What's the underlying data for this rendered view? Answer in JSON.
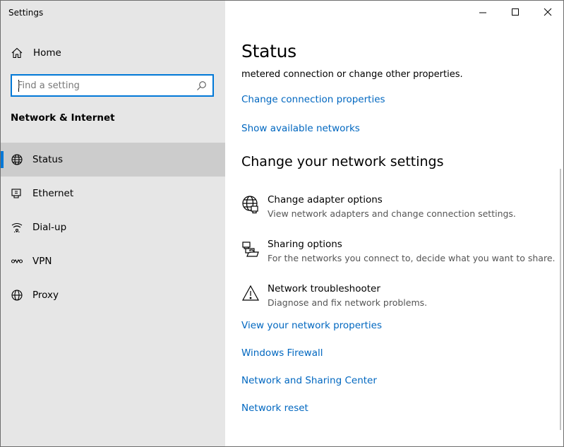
{
  "window": {
    "title": "Settings"
  },
  "sidebar": {
    "home_label": "Home",
    "search_placeholder": "Find a setting",
    "section_title": "Network & Internet",
    "items": [
      {
        "label": "Status",
        "icon": "globe-icon",
        "active": true
      },
      {
        "label": "Ethernet",
        "icon": "ethernet-icon",
        "active": false
      },
      {
        "label": "Dial-up",
        "icon": "dialup-icon",
        "active": false
      },
      {
        "label": "VPN",
        "icon": "vpn-icon",
        "active": false
      },
      {
        "label": "Proxy",
        "icon": "globe-icon",
        "active": false
      }
    ]
  },
  "main": {
    "title": "Status",
    "partial_text": "metered connection or change other properties.",
    "links_top": [
      "Change connection properties",
      "Show available networks"
    ],
    "section_title": "Change your network settings",
    "options": [
      {
        "title": "Change adapter options",
        "description": "View network adapters and change connection settings.",
        "icon": "adapter-icon"
      },
      {
        "title": "Sharing options",
        "description": "For the networks you connect to, decide what you want to share.",
        "icon": "sharing-icon"
      },
      {
        "title": "Network troubleshooter",
        "description": "Diagnose and fix network problems.",
        "icon": "warning-icon"
      }
    ],
    "links_bottom": [
      "View your network properties",
      "Windows Firewall",
      "Network and Sharing Center",
      "Network reset"
    ]
  },
  "colors": {
    "accent": "#0078d7",
    "link": "#0067c0",
    "sidebar_bg": "#e6e6e6",
    "active_bg": "#cccccc"
  }
}
